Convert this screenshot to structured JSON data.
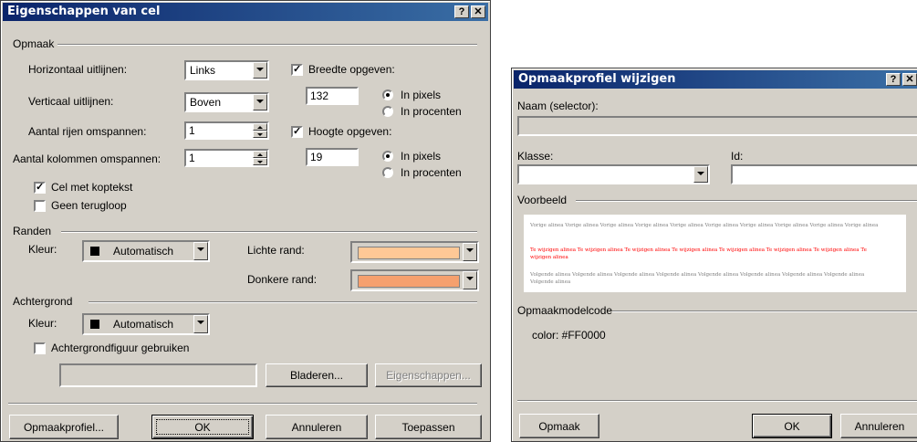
{
  "dialog1": {
    "title": "Eigenschappen van cel",
    "help": "?",
    "close": "✕",
    "section_layout": "Opmaak",
    "h_align_label": "Horizontaal uitlijnen:",
    "h_align_value": "Links",
    "v_align_label": "Verticaal uitlijnen:",
    "v_align_value": "Boven",
    "rowspan_label": "Aantal rijen omspannen:",
    "rowspan_value": "1",
    "colspan_label": "Aantal kolommen omspannen:",
    "colspan_value": "1",
    "width_check_label": "Breedte opgeven:",
    "width_value": "132",
    "width_pixels": "In pixels",
    "width_percent": "In procenten",
    "height_check_label": "Hoogte opgeven:",
    "height_value": "19",
    "height_pixels": "In pixels",
    "height_percent": "In procenten",
    "header_cell_label": "Cel met koptekst",
    "nowrap_label": "Geen terugloop",
    "section_borders": "Randen",
    "border_color_label": "Kleur:",
    "border_color_value": "Automatisch",
    "light_border_label": "Lichte rand:",
    "dark_border_label": "Donkere rand:",
    "section_background": "Achtergrond",
    "bg_color_label": "Kleur:",
    "bg_color_value": "Automatisch",
    "bg_image_label": "Achtergrondfiguur gebruiken",
    "browse_button": "Bladeren...",
    "properties_button": "Eigenschappen...",
    "style_button": "Opmaakprofiel...",
    "ok_button": "OK",
    "cancel_button": "Annuleren",
    "apply_button": "Toepassen"
  },
  "dialog2": {
    "title": "Opmaakprofiel wijzigen",
    "help": "?",
    "close": "✕",
    "name_label": "Naam (selector):",
    "name_value": "",
    "class_label": "Klasse:",
    "class_value": "",
    "id_label": "Id:",
    "id_value": "",
    "preview_label": "Voorbeeld",
    "preview_before": "Vorige alinea Vorige alinea Vorige alinea Vorige alinea Vorige alinea Vorige alinea Vorige alinea Vorige alinea Vorige alinea Vorige alinea",
    "preview_current": "Te wijzigen alinea Te wijzigen alinea Te wijzigen alinea Te wijzigen alinea Te wijzigen alinea Te wijzigen alinea Te wijzigen alinea Te wijzigen alinea",
    "preview_after": "Volgende alinea Volgende alinea Volgende alinea Volgende alinea Volgende alinea Volgende alinea Volgende alinea Volgende alinea Volgende alinea",
    "code_label": "Opmaakmodelcode",
    "code_value": "color: #FF0000",
    "format_button": "Opmaak",
    "ok_button": "OK",
    "cancel_button": "Annuleren"
  },
  "colors": {
    "title_gradient_start": "#0a246a",
    "title_gradient_end": "#3a6ea5",
    "dialog_bg": "#d4d0c8",
    "light_border_swatch": "#ffc896",
    "dark_border_swatch": "#f5a06e",
    "preview_red": "#ff0000",
    "preview_gray": "#808080"
  }
}
